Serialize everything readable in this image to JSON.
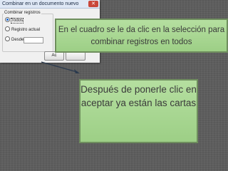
{
  "dialog": {
    "title": "Combinar en un documento nuevo",
    "close_glyph": "✕",
    "group_label": "Combinar registros",
    "options": [
      {
        "label": "Todos",
        "selected": true
      },
      {
        "label": "Registro actual",
        "selected": false
      },
      {
        "label": "Desde:",
        "selected": false
      }
    ],
    "accept_button": "Ac",
    "cancel_button": ""
  },
  "callouts": {
    "top_text": "En el cuadro se le da clic en la selección para combinar registros en todos",
    "bottom_text": "Después de ponerle clic en aceptar ya están las cartas"
  },
  "colors": {
    "background": "#5e5e5e",
    "callout_fill": "#a8d892",
    "callout_border": "#6f8e5e",
    "callout_text": "#3b3b3b"
  }
}
